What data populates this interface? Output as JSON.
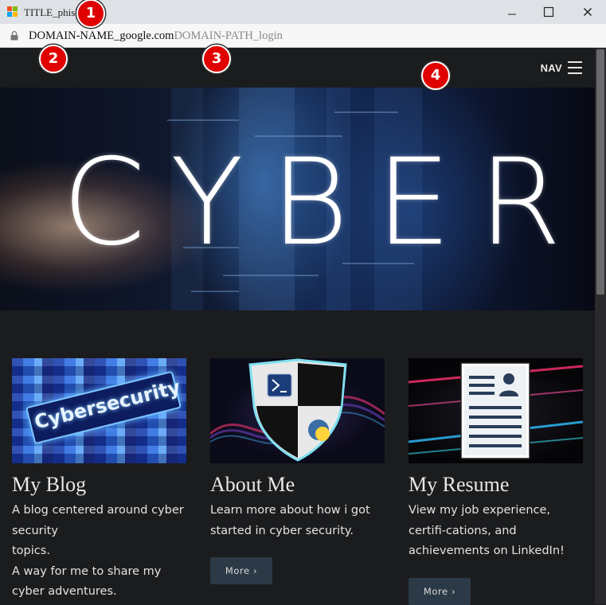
{
  "browser": {
    "tab_title": "TITLE_phish",
    "url_domain": "DOMAIN-NAME_google.com",
    "url_path": "DOMAIN-PATH_login",
    "window_buttons": {
      "minimize": "—",
      "maximize": "☐",
      "close": "✕"
    }
  },
  "header": {
    "nav_label": "NAV"
  },
  "hero": {
    "word": "CYBER"
  },
  "cards": [
    {
      "title": "My Blog",
      "lines": [
        "A blog centered around cyber security",
        "topics.",
        "A way for me to share my cyber adventures."
      ],
      "image_label": "Cybersecurity"
    },
    {
      "title": "About Me",
      "lines": [
        "Learn more about how i got started in cyber security."
      ],
      "button": "More ›"
    },
    {
      "title": "My Resume",
      "lines": [
        "View my job experience, certifi-cations, and achievements on LinkedIn!"
      ],
      "button": "More ›"
    }
  ],
  "markers": [
    "1",
    "2",
    "3",
    "4"
  ],
  "colors": {
    "background": "#1b1c1e",
    "button_bg": "#2c3a47",
    "marker": "#e00000"
  }
}
